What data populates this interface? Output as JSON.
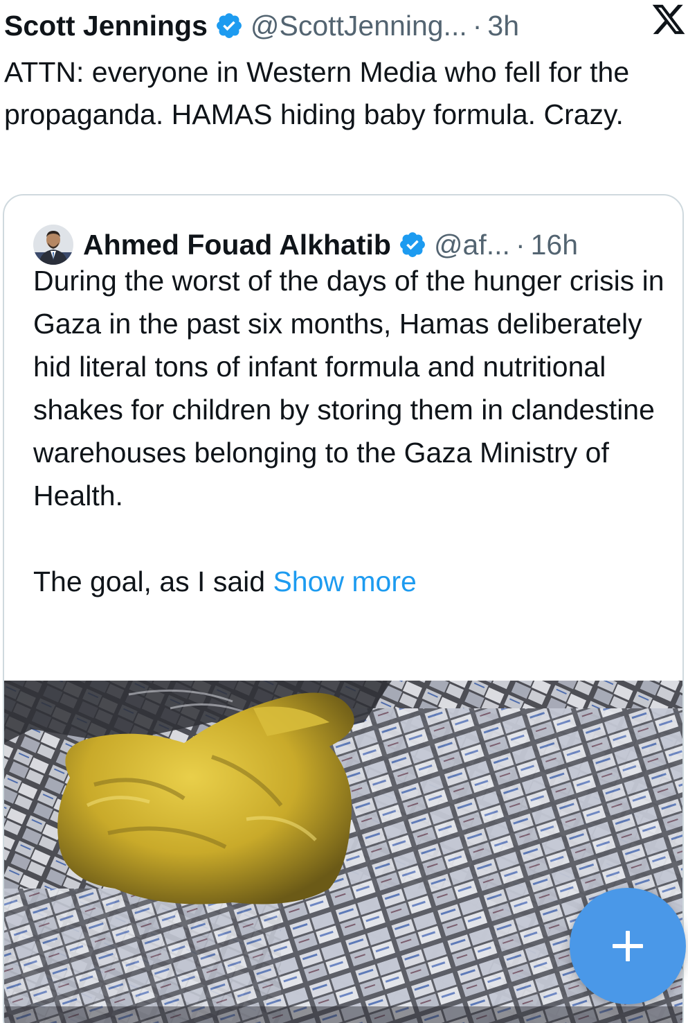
{
  "tweet": {
    "author_name": "Scott Jennings",
    "handle": "@ScottJenning...",
    "separator": "·",
    "time": "3h",
    "text": "ATTN: everyone in Western Media who fell for the propaganda. HAMAS hiding baby formula. Crazy."
  },
  "quoted_tweet": {
    "author_name": "Ahmed Fouad Alkhatib",
    "handle": "@af...",
    "separator": "·",
    "time": "16h",
    "text_paragraph_1": "During the worst of the days of the hunger crisis in Gaza in the past six months, Hamas deliberately hid literal tons of infant formula and nutritional shakes for children by storing them in clandestine warehouses belonging to the Gaza Ministry of Health.",
    "text_paragraph_2": "The goal, as I said",
    "show_more": "Show more"
  },
  "icons": {
    "verified": "verified-badge-icon",
    "app_logo": "x-logo-icon",
    "compose": "plus-icon"
  },
  "colors": {
    "verified_blue": "#1d9bf0",
    "link_blue": "#1d9bf0",
    "secondary_text": "#536471",
    "fab": "#4a98e8"
  }
}
